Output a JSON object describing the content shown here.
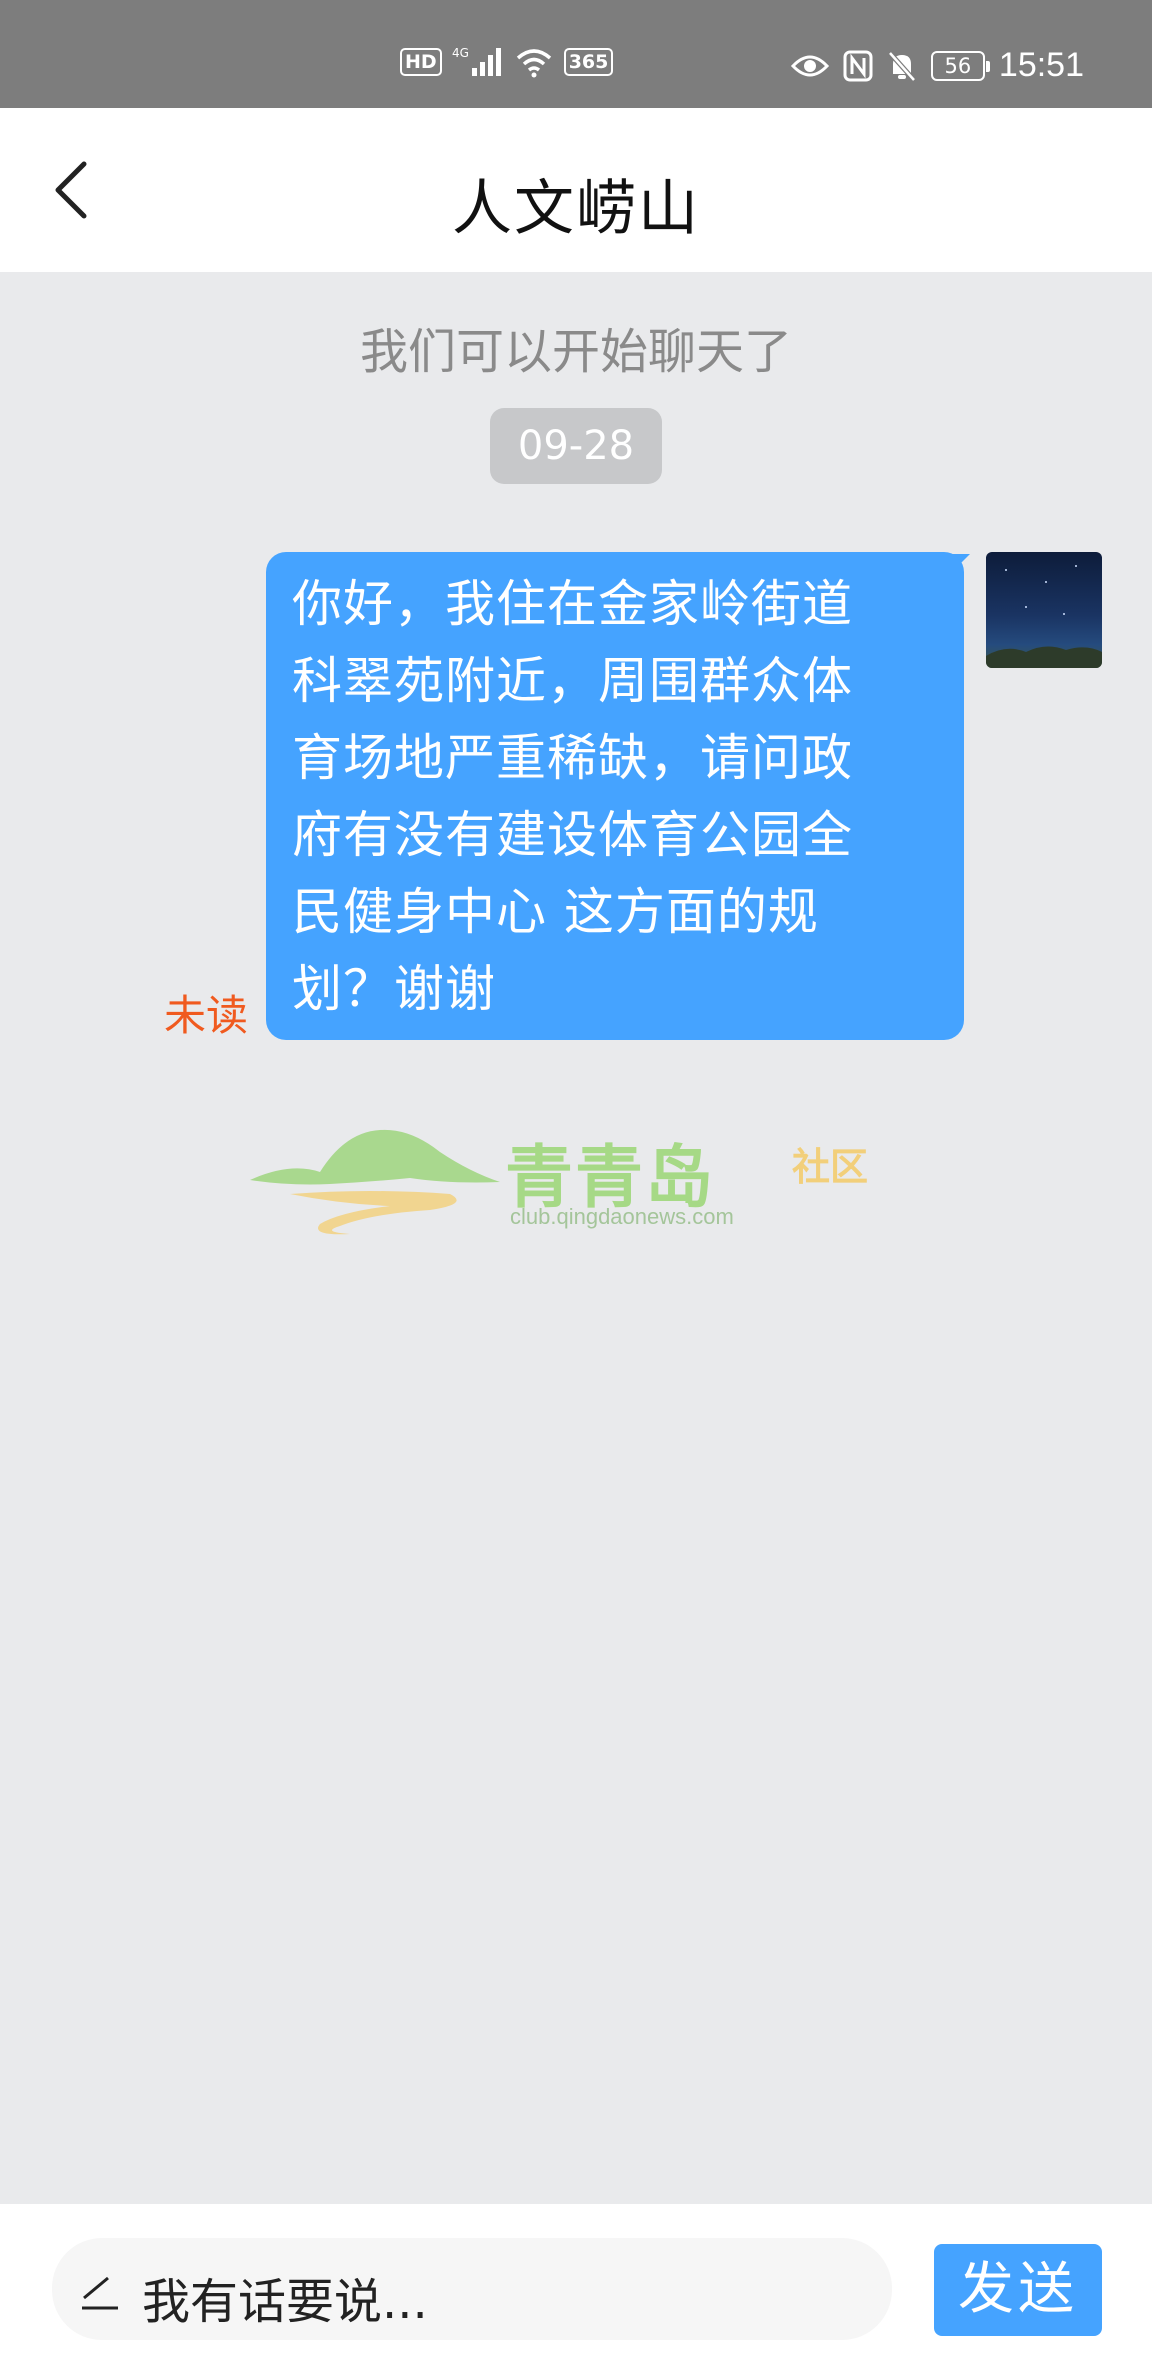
{
  "status_bar": {
    "network_badges": [
      "HD",
      "4G",
      "365"
    ],
    "battery": "56",
    "time": "15:51"
  },
  "header": {
    "title": "人文崂山"
  },
  "chat": {
    "system_note": "我们可以开始聊天了",
    "date": "09-28",
    "messages": [
      {
        "sender": "me",
        "lines": [
          "你好，我住在金家岭街道",
          "科翠苑附近，周围群众体",
          "育场地严重稀缺，请问政",
          "府有没有建设体育公园全",
          "民健身中心 这方面的规",
          "划？谢谢"
        ],
        "status": "未读"
      }
    ]
  },
  "watermark": {
    "name": "青青岛",
    "suffix": "社区",
    "url": "club.qingdaonews.com"
  },
  "input_bar": {
    "placeholder": "我有话要说...",
    "send_label": "发送"
  },
  "colors": {
    "accent": "#45a3ff",
    "unread": "#f05a1f",
    "background": "#e9eaec"
  }
}
